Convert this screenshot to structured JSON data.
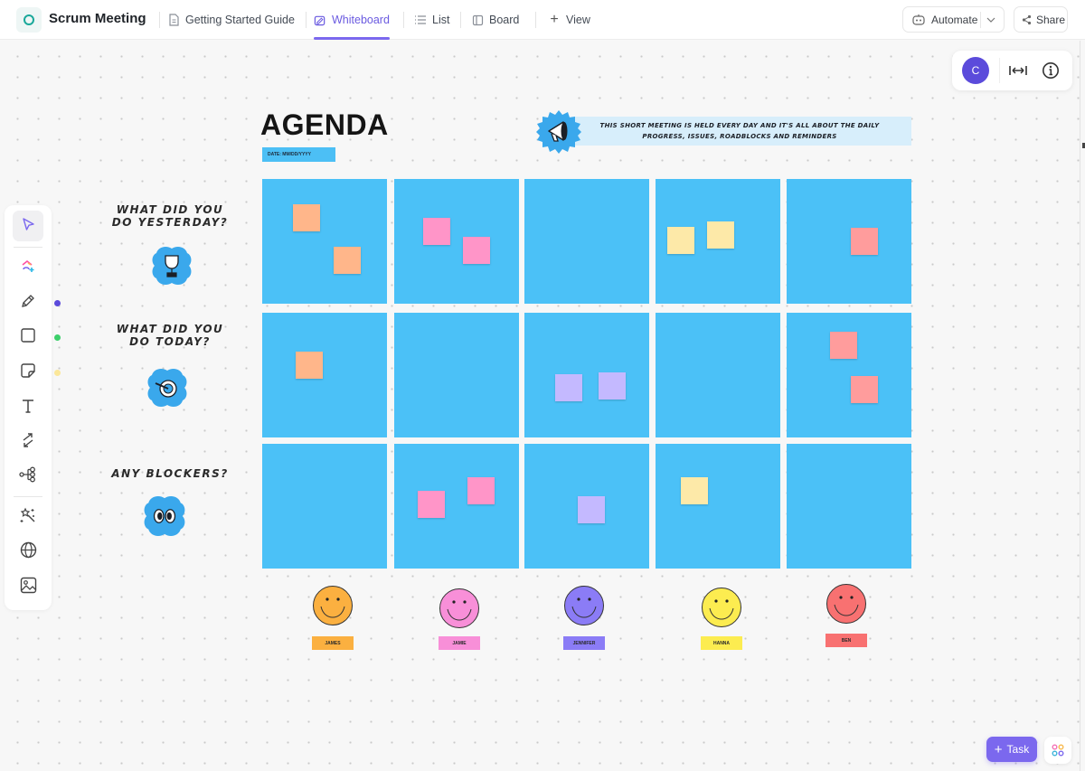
{
  "header": {
    "space_title": "Scrum Meeting",
    "tabs": [
      {
        "label": "Getting Started Guide",
        "icon": "doc-icon",
        "active": false
      },
      {
        "label": "Whiteboard",
        "icon": "whiteboard-icon",
        "active": true
      },
      {
        "label": "List",
        "icon": "list-icon",
        "active": false
      },
      {
        "label": "Board",
        "icon": "board-icon",
        "active": false
      }
    ],
    "add_view_label": "View",
    "automate_label": "Automate",
    "share_label": "Share"
  },
  "float_panel": {
    "avatar_initial": "C",
    "fit_icon": "fit-width-icon",
    "info_icon": "info-icon"
  },
  "toolbar": {
    "tools": [
      "select",
      "clickup-ai-create",
      "pen",
      "shape",
      "sticky-note",
      "text",
      "connector",
      "mind-map",
      "ai-magic",
      "embed-web",
      "image"
    ],
    "color_dots": {
      "pen": "#5b4bdb",
      "shape": "#3ccf6a",
      "sticky": "#fbe79a"
    }
  },
  "board": {
    "title": "AGENDA",
    "date_label": "DATE: MM/DD/YYYY",
    "banner_text": "THIS SHORT MEETING IS HELD EVERY DAY AND IT'S ALL ABOUT THE DAILY PROGRESS, ISSUES, ROADBLOCKS AND REMINDERS",
    "rows": [
      {
        "label_line1": "WHAT DID YOU",
        "label_line2": "DO YESTERDAY?",
        "icon": "trophy-icon"
      },
      {
        "label_line1": "WHAT DID YOU",
        "label_line2": "DO TODAY?",
        "icon": "target-icon"
      },
      {
        "label_line1": "ANY BLOCKERS?",
        "label_line2": "",
        "icon": "eyes-icon"
      }
    ],
    "cell_color": "#4bc1f7",
    "members": [
      {
        "name": "JAMES",
        "color": "#fbb040",
        "tag_color": "#fbb040"
      },
      {
        "name": "JAMIE",
        "color": "#f88fd8",
        "tag_color": "#f88fd8"
      },
      {
        "name": "JENNIFER",
        "color": "#8b7cf6",
        "tag_color": "#8b7cf6"
      },
      {
        "name": "HANNA",
        "color": "#fcec50",
        "tag_color": "#fcec50"
      },
      {
        "name": "BEN",
        "color": "#f87171",
        "tag_color": "#f87171"
      }
    ],
    "sticky_colors": {
      "orange": "#ffb68a",
      "pink": "#ff95c8",
      "yellow": "#fde9a8",
      "lavender": "#c4b9ff",
      "salmon": "#ff9c9c"
    }
  },
  "footer": {
    "task_label": "Task",
    "apps_icon": "apps-grid-icon"
  }
}
